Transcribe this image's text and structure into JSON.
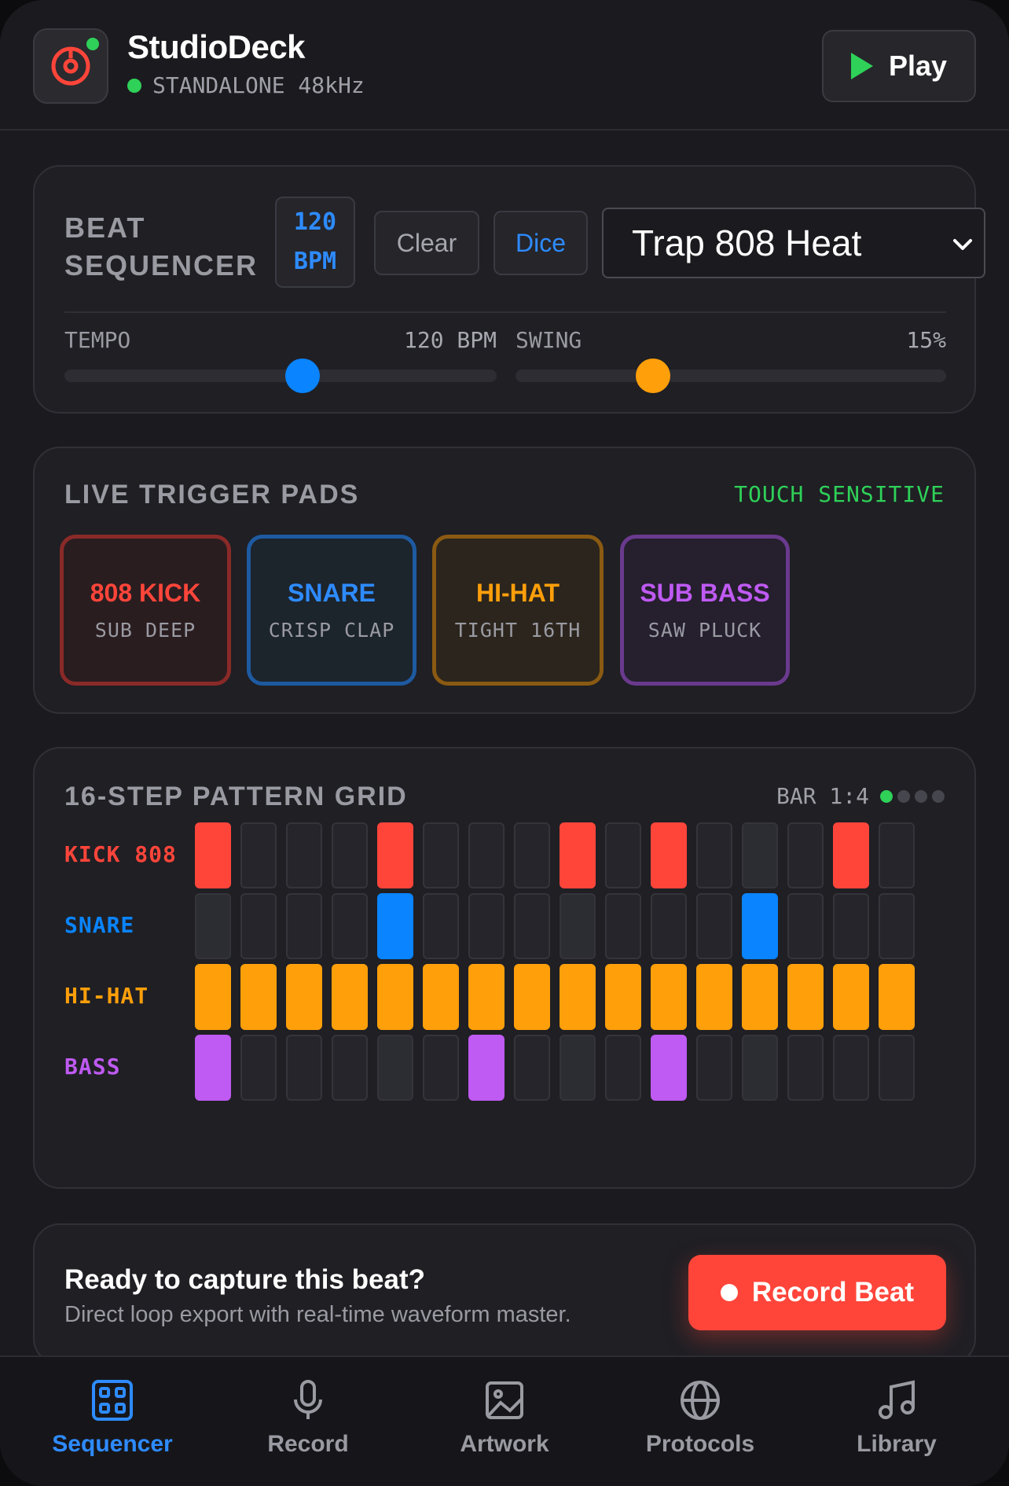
{
  "header": {
    "app_name": "StudioDeck",
    "status": "STANDALONE 48kHz",
    "play_label": "Play"
  },
  "sequencer": {
    "title": "BEAT SEQUENCER",
    "bpm_value": "120",
    "bpm_unit": "BPM",
    "clear_label": "Clear",
    "dice_label": "Dice",
    "preset": "Trap 808 Heat",
    "tempo_label": "TEMPO",
    "tempo_value": "120 BPM",
    "tempo_level": 0.55,
    "swing_label": "SWING",
    "swing_value": "15%",
    "swing_level": 0.32,
    "colors": {
      "accent": "#2e8bff",
      "swing": "#ff9f0a"
    }
  },
  "pads": {
    "title": "LIVE TRIGGER PADS",
    "mode": "TOUCH SENSITIVE",
    "items": [
      {
        "name": "808 KICK",
        "sub": "SUB DEEP",
        "color": "#ff453a",
        "bg": "#2a1d20",
        "border": "#8a2a28"
      },
      {
        "name": "SNARE",
        "sub": "CRISP CLAP",
        "color": "#2e8bff",
        "bg": "#1c242c",
        "border": "#1e5aa0"
      },
      {
        "name": "HI-HAT",
        "sub": "TIGHT 16TH",
        "color": "#ff9f0a",
        "bg": "#2b251d",
        "border": "#8a5a12"
      },
      {
        "name": "SUB BASS",
        "sub": "SAW PLUCK",
        "color": "#bf5af2",
        "bg": "#251f2e",
        "border": "#6a3a8e"
      }
    ]
  },
  "grid": {
    "title": "16-STEP PATTERN GRID",
    "bar": "BAR 1:4",
    "tracks": [
      {
        "name": "KICK 808",
        "color": "#ff453a",
        "steps": [
          1,
          0,
          0,
          0,
          1,
          0,
          0,
          0,
          1,
          0,
          1,
          0,
          0,
          0,
          1,
          0
        ]
      },
      {
        "name": "SNARE",
        "color": "#0a84ff",
        "steps": [
          0,
          0,
          0,
          0,
          1,
          0,
          0,
          0,
          0,
          0,
          0,
          0,
          1,
          0,
          0,
          0
        ]
      },
      {
        "name": "HI-HAT",
        "color": "#ff9f0a",
        "steps": [
          1,
          1,
          1,
          1,
          1,
          1,
          1,
          1,
          1,
          1,
          1,
          1,
          1,
          1,
          1,
          1
        ]
      },
      {
        "name": "BASS",
        "color": "#bf5af2",
        "steps": [
          1,
          0,
          0,
          0,
          0,
          0,
          1,
          0,
          0,
          0,
          1,
          0,
          0,
          0,
          0,
          0
        ]
      }
    ]
  },
  "record": {
    "title": "Ready to capture this beat?",
    "subtitle": "Direct loop export with real-time waveform master.",
    "button_label": "Record Beat"
  },
  "nav": {
    "items": [
      {
        "label": "Sequencer",
        "icon": "grid-icon",
        "active": true
      },
      {
        "label": "Record",
        "icon": "microphone-icon",
        "active": false
      },
      {
        "label": "Artwork",
        "icon": "image-icon",
        "active": false
      },
      {
        "label": "Protocols",
        "icon": "globe-icon",
        "active": false
      },
      {
        "label": "Library",
        "icon": "music-note-icon",
        "active": false
      }
    ]
  }
}
